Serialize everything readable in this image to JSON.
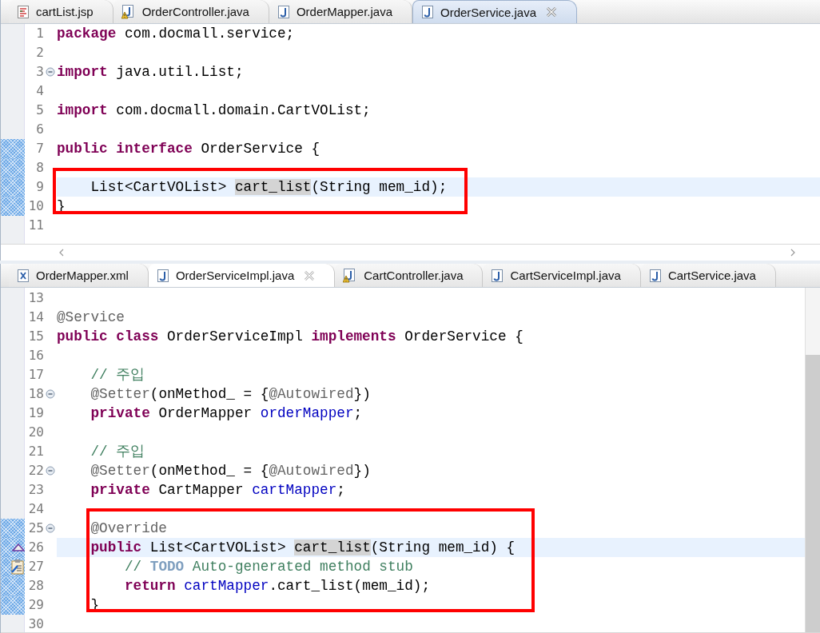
{
  "panes": [
    {
      "active": true,
      "tabs": [
        {
          "label": "cartList.jsp",
          "kind": "jsp",
          "selected": false,
          "closable": false
        },
        {
          "label": "OrderController.java",
          "kind": "java-warning",
          "selected": false,
          "closable": false
        },
        {
          "label": "OrderMapper.java",
          "kind": "java",
          "selected": false,
          "closable": false
        },
        {
          "label": "OrderService.java",
          "kind": "java",
          "selected": true,
          "closable": true
        }
      ],
      "lines": [
        {
          "number": "1",
          "kind": "code",
          "changed": false,
          "fold": false,
          "current": false,
          "boxed": false,
          "segments": [
            {
              "kind": "k",
              "text": "package"
            },
            {
              "kind": "p",
              "text": " com.docmall.service;"
            }
          ]
        },
        {
          "number": "2",
          "kind": "code",
          "changed": false,
          "fold": false,
          "current": false,
          "boxed": false
        },
        {
          "number": "3",
          "kind": "code",
          "changed": false,
          "fold": true,
          "current": false,
          "boxed": false,
          "segments": [
            {
              "kind": "k",
              "text": "import"
            },
            {
              "kind": "p",
              "text": " java.util.List;"
            }
          ]
        },
        {
          "number": "4",
          "kind": "code",
          "changed": false,
          "fold": false,
          "current": false,
          "boxed": false
        },
        {
          "number": "5",
          "kind": "code",
          "changed": false,
          "fold": false,
          "current": false,
          "boxed": false,
          "segments": [
            {
              "kind": "k",
              "text": "import"
            },
            {
              "kind": "p",
              "text": " com.docmall.domain.CartVOList;"
            }
          ]
        },
        {
          "number": "6",
          "kind": "code",
          "changed": false,
          "fold": false,
          "current": false,
          "boxed": false
        },
        {
          "number": "7",
          "kind": "code",
          "changed": true,
          "fold": false,
          "current": false,
          "boxed": false,
          "segments": [
            {
              "kind": "k",
              "text": "public interface"
            },
            {
              "kind": "p",
              "text": " OrderService {"
            }
          ]
        },
        {
          "number": "8",
          "kind": "code",
          "changed": true,
          "fold": false,
          "current": false,
          "boxed": false
        },
        {
          "number": "9",
          "kind": "code",
          "changed": true,
          "fold": false,
          "current": true,
          "boxed": true,
          "segments": [
            {
              "kind": "p",
              "text": "    List<CartVOList> "
            },
            {
              "kind": "o",
              "text": "cart_list"
            },
            {
              "kind": "p",
              "text": "(String mem_id);"
            }
          ]
        },
        {
          "number": "10",
          "kind": "code",
          "changed": true,
          "fold": false,
          "current": false,
          "boxed": true,
          "segments": [
            {
              "kind": "p",
              "text": "}"
            }
          ]
        },
        {
          "number": "11",
          "kind": "code",
          "changed": false,
          "fold": false,
          "current": false,
          "boxed": false
        }
      ]
    },
    {
      "active": false,
      "tabs": [
        {
          "label": "OrderMapper.xml",
          "kind": "xml",
          "selected": false,
          "closable": false
        },
        {
          "label": "OrderServiceImpl.java",
          "kind": "java",
          "selected": true,
          "closable": true
        },
        {
          "label": "CartController.java",
          "kind": "java-warning",
          "selected": false,
          "closable": false
        },
        {
          "label": "CartServiceImpl.java",
          "kind": "java",
          "selected": false,
          "closable": false
        },
        {
          "label": "CartService.java",
          "kind": "java",
          "selected": false,
          "closable": false
        }
      ],
      "lines": [
        {
          "number": "13",
          "kind": "code",
          "changed": false,
          "fold": false,
          "current": false,
          "boxed": false
        },
        {
          "number": "14",
          "kind": "code",
          "changed": false,
          "fold": false,
          "current": false,
          "boxed": false,
          "segments": [
            {
              "kind": "a",
              "text": "@Service"
            }
          ]
        },
        {
          "number": "15",
          "kind": "code",
          "changed": false,
          "fold": false,
          "current": false,
          "boxed": false,
          "segments": [
            {
              "kind": "k",
              "text": "public class"
            },
            {
              "kind": "p",
              "text": " OrderServiceImpl "
            },
            {
              "kind": "k",
              "text": "implements"
            },
            {
              "kind": "p",
              "text": " OrderService {"
            }
          ]
        },
        {
          "number": "16",
          "kind": "code",
          "changed": false,
          "fold": false,
          "current": false,
          "boxed": false
        },
        {
          "number": "17",
          "kind": "code",
          "changed": false,
          "fold": false,
          "current": false,
          "boxed": false,
          "segments": [
            {
              "kind": "c",
              "text": "    // 주입"
            }
          ]
        },
        {
          "number": "18",
          "kind": "code",
          "changed": false,
          "fold": true,
          "current": false,
          "boxed": false,
          "segments": [
            {
              "kind": "a",
              "text": "    @Setter"
            },
            {
              "kind": "p",
              "text": "(onMethod_ = {"
            },
            {
              "kind": "a",
              "text": "@Autowired"
            },
            {
              "kind": "p",
              "text": "})"
            }
          ]
        },
        {
          "number": "19",
          "kind": "code",
          "changed": false,
          "fold": false,
          "current": false,
          "boxed": false,
          "segments": [
            {
              "kind": "k",
              "text": "    private"
            },
            {
              "kind": "p",
              "text": " OrderMapper "
            },
            {
              "kind": "f",
              "text": "orderMapper"
            },
            {
              "kind": "p",
              "text": ";"
            }
          ]
        },
        {
          "number": "20",
          "kind": "code",
          "changed": false,
          "fold": false,
          "current": false,
          "boxed": false
        },
        {
          "number": "21",
          "kind": "code",
          "changed": false,
          "fold": false,
          "current": false,
          "boxed": false,
          "segments": [
            {
              "kind": "c",
              "text": "    // 주입"
            }
          ]
        },
        {
          "number": "22",
          "kind": "code",
          "changed": false,
          "fold": true,
          "current": false,
          "boxed": false,
          "segments": [
            {
              "kind": "a",
              "text": "    @Setter"
            },
            {
              "kind": "p",
              "text": "(onMethod_ = {"
            },
            {
              "kind": "a",
              "text": "@Autowired"
            },
            {
              "kind": "p",
              "text": "})"
            }
          ]
        },
        {
          "number": "23",
          "kind": "code",
          "changed": false,
          "fold": false,
          "current": false,
          "boxed": false,
          "segments": [
            {
              "kind": "k",
              "text": "    private"
            },
            {
              "kind": "p",
              "text": " CartMapper "
            },
            {
              "kind": "f",
              "text": "cartMapper"
            },
            {
              "kind": "p",
              "text": ";"
            }
          ]
        },
        {
          "number": "24",
          "kind": "code",
          "changed": false,
          "fold": false,
          "current": false,
          "boxed": false
        },
        {
          "number": "25",
          "kind": "code",
          "changed": true,
          "fold": true,
          "current": false,
          "boxed": true,
          "segments": [
            {
              "kind": "a",
              "text": "    @Override"
            }
          ]
        },
        {
          "number": "26",
          "kind": "override",
          "changed": true,
          "fold": false,
          "current": true,
          "boxed": true,
          "segments": [
            {
              "kind": "k",
              "text": "    public"
            },
            {
              "kind": "p",
              "text": " List<CartVOList> "
            },
            {
              "kind": "o",
              "text": "cart_list"
            },
            {
              "kind": "p",
              "text": "(String mem_id) {"
            }
          ]
        },
        {
          "number": "27",
          "kind": "task",
          "changed": true,
          "fold": false,
          "current": false,
          "boxed": true,
          "segments": [
            {
              "kind": "c",
              "text": "        // "
            },
            {
              "kind": "t",
              "text": "TODO"
            },
            {
              "kind": "c",
              "text": " Auto-generated method stub"
            }
          ]
        },
        {
          "number": "28",
          "kind": "code",
          "changed": true,
          "fold": false,
          "current": false,
          "boxed": true,
          "segments": [
            {
              "kind": "k",
              "text": "        return "
            },
            {
              "kind": "f",
              "text": "cartMapper"
            },
            {
              "kind": "p",
              "text": ".cart_list(mem_id);"
            }
          ]
        },
        {
          "number": "29",
          "kind": "code",
          "changed": true,
          "fold": false,
          "current": false,
          "boxed": true,
          "segments": [
            {
              "kind": "p",
              "text": "    }"
            }
          ]
        },
        {
          "number": "30",
          "kind": "code",
          "changed": false,
          "fold": false,
          "current": false,
          "boxed": false
        }
      ]
    }
  ]
}
